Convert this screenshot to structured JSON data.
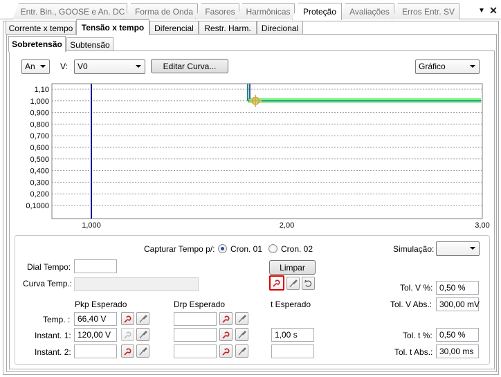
{
  "top_tabs": [
    "Entr. Bin., GOOSE e An. DC",
    "Forma de Onda",
    "Fasores",
    "Harmônicas",
    "Proteção",
    "Avaliações",
    "Erros Entr. SV"
  ],
  "sub_tabs": [
    "Corrente x tempo",
    "Tensão x tempo",
    "Diferencial",
    "Restr. Harm.",
    "Direcional"
  ],
  "mode_tabs": [
    "Sobretensão",
    "Subtensão"
  ],
  "toolbar": {
    "phase_select": "An",
    "v_label": "V:",
    "v_select": "V0",
    "edit_curve": "Editar Curva...",
    "view_select": "Gráfico"
  },
  "chart_data": {
    "type": "line",
    "y_ticks": [
      "1,10",
      "1,000",
      "0,900",
      "0,800",
      "0,700",
      "0,600",
      "0,500",
      "0,400",
      "0,300",
      "0,200",
      "0,1000"
    ],
    "x_ticks": [
      "1,000",
      "2,00",
      "3,00"
    ],
    "xlim": [
      1.0,
      3.0
    ],
    "grid": true,
    "vertical_marker_x": 1.0,
    "pickup_curve": {
      "x_start": 1.8,
      "y": 1.0,
      "x_end": 3.0
    },
    "cursor": {
      "x": 1.84,
      "y": 1.0
    },
    "colors": {
      "marker": "#0a1a8c",
      "curve": "#1a8f7a",
      "band": "#6ef07a",
      "cursor": "#e6a23a"
    }
  },
  "capture": {
    "label": "Capturar Tempo p/:",
    "options": [
      "Cron. 01",
      "Cron. 02"
    ],
    "selected": "Cron. 01",
    "simulation_label": "Simulação:",
    "simulation_value": ""
  },
  "dial": {
    "label": "Dial Tempo:",
    "value": ""
  },
  "curve_temp": {
    "label": "Curva Temp.:",
    "value": ""
  },
  "clear_button": "Limpar",
  "tolerances": {
    "tol_v_pct_label": "Tol. V %:",
    "tol_v_pct": "0,50 %",
    "tol_v_abs_label": "Tol. V Abs.:",
    "tol_v_abs": "300,00 mV",
    "tol_t_pct_label": "Tol. t %:",
    "tol_t_pct": "0,50 %",
    "tol_t_abs_label": "Tol. t Abs.:",
    "tol_t_abs": "30,00 ms"
  },
  "headers": {
    "pkp": "Pkp Esperado",
    "drp": "Drp Esperado",
    "t": "t Esperado"
  },
  "rows": [
    {
      "label": "Temp. :",
      "pkp": "66,40 V",
      "drp": "",
      "t": null
    },
    {
      "label": "Instant. 1:",
      "pkp": "120,00 V",
      "drp": "",
      "t": "1,00 s"
    },
    {
      "label": "Instant. 2:",
      "pkp": "",
      "drp": "",
      "t": ""
    }
  ]
}
